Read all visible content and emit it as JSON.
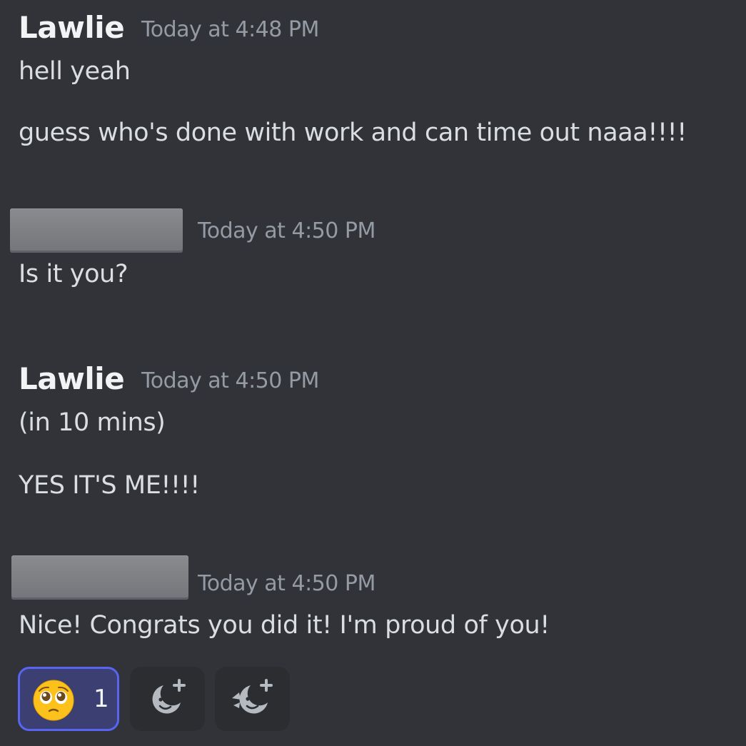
{
  "messages": [
    {
      "author": "Lawlie",
      "timestamp": "Today at 4:48 PM",
      "lines": [
        "hell yeah",
        "guess who's done with work and can time out naaa!!!!"
      ]
    },
    {
      "author_redacted": true,
      "timestamp": "Today at 4:50 PM",
      "lines": [
        "Is it you?"
      ]
    },
    {
      "author": "Lawlie",
      "timestamp": "Today at 4:50 PM",
      "lines": [
        "(in 10 mins)",
        "YES IT'S ME!!!!"
      ]
    },
    {
      "author_redacted": true,
      "timestamp": "Today at 4:50 PM",
      "lines": [
        "Nice! Congrats you did it! I'm proud of you!"
      ]
    }
  ],
  "reactions": [
    {
      "emoji": "pleading-face-icon",
      "count": "1",
      "active": true
    },
    {
      "emoji": "add-reaction-icon"
    },
    {
      "emoji": "add-super-reaction-icon"
    }
  ],
  "colors": {
    "background": "#313338",
    "text": "#dbdee1",
    "username": "#f2f3f5",
    "timestamp": "#949ba4",
    "accent": "#5865f2"
  }
}
